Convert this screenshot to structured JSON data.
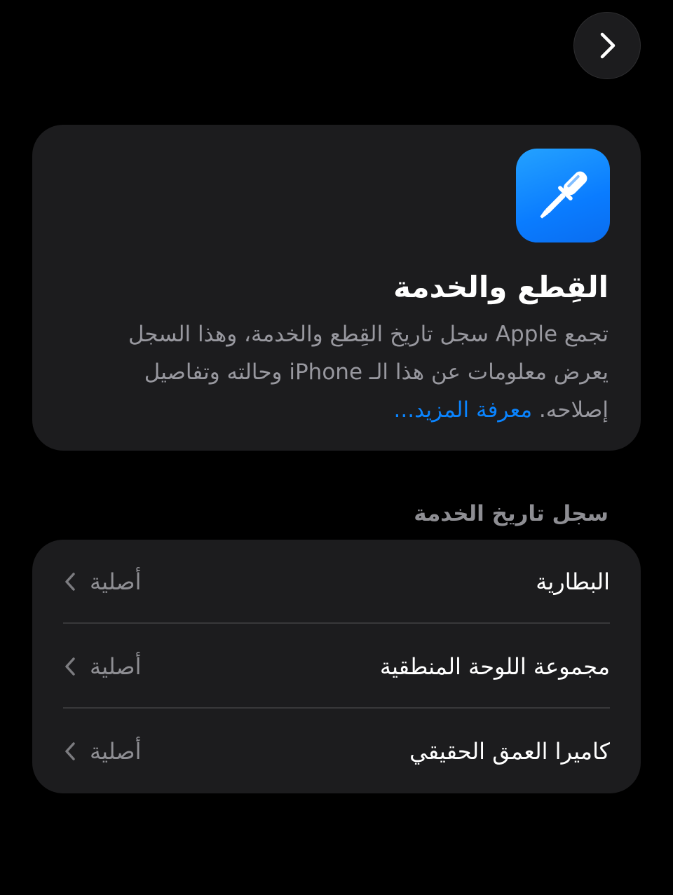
{
  "nav": {
    "icon": "chevron-right-icon"
  },
  "info_card": {
    "icon": "screwdriver-icon",
    "icon_color": "#0a84ff",
    "title": "القِطع والخدمة",
    "description": "تجمع Apple سجل تاريخ القِطع والخدمة، وهذا السجل يعرض معلومات عن هذا الـ iPhone وحالته وتفاصيل إصلاحه.",
    "learn_more": "معرفة المزيد...",
    "link_color": "#0a84ff"
  },
  "service_history": {
    "header": "سجل تاريخ الخدمة",
    "items": [
      {
        "label": "البطارية",
        "value": "أصلية"
      },
      {
        "label": "مجموعة اللوحة المنطقية",
        "value": "أصلية"
      },
      {
        "label": "كاميرا العمق الحقيقي",
        "value": "أصلية"
      }
    ]
  }
}
